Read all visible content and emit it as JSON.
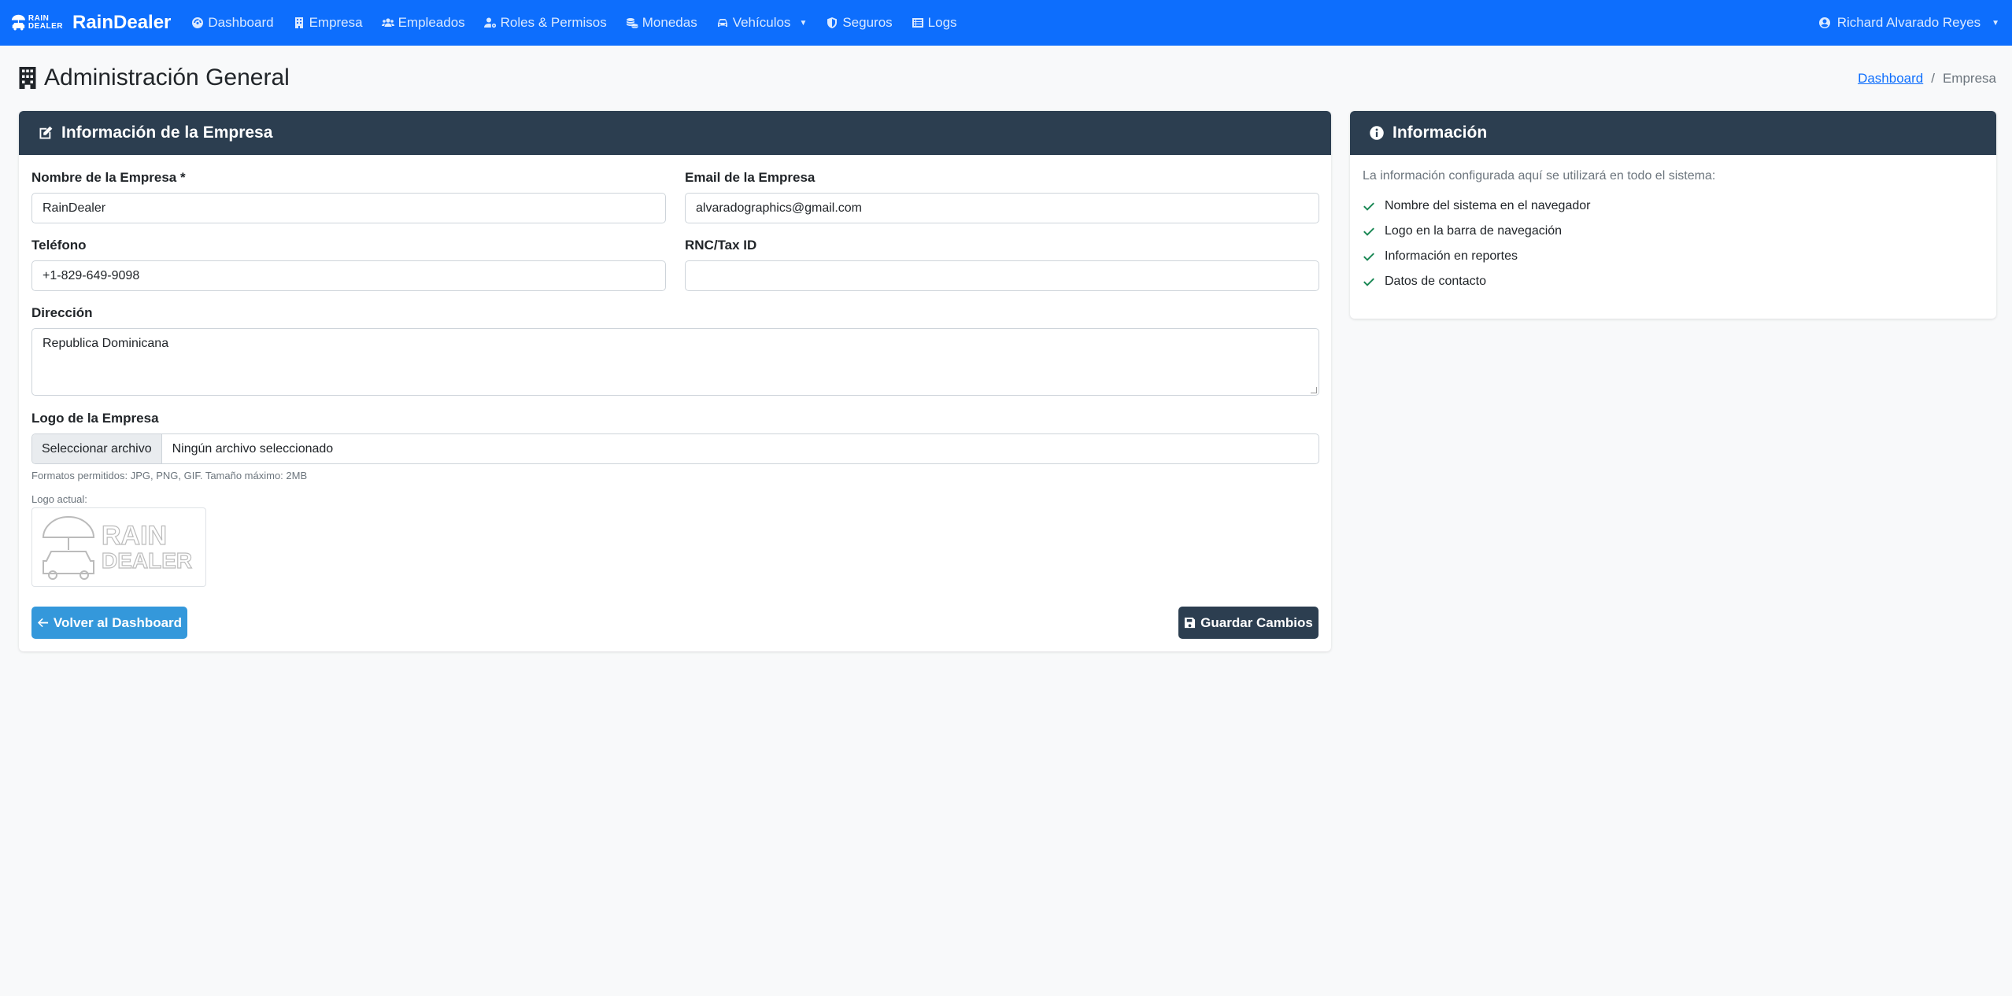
{
  "navbar": {
    "logo_line1": "RAIN",
    "logo_line2": "DEALER",
    "brand": "RainDealer",
    "items": [
      {
        "label": "Dashboard",
        "icon": "tachometer-icon"
      },
      {
        "label": "Empresa",
        "icon": "building-icon"
      },
      {
        "label": "Empleados",
        "icon": "users-icon"
      },
      {
        "label": "Roles & Permisos",
        "icon": "user-cog-icon"
      },
      {
        "label": "Monedas",
        "icon": "coins-icon"
      },
      {
        "label": "Vehículos",
        "icon": "car-icon"
      },
      {
        "label": "Seguros",
        "icon": "shield-icon"
      },
      {
        "label": "Logs",
        "icon": "list-icon"
      }
    ],
    "user": "Richard Alvarado Reyes"
  },
  "page": {
    "title": "Administración General",
    "breadcrumb": [
      "Dashboard",
      "/",
      "Empresa"
    ]
  },
  "company_card": {
    "header": "Información de la Empresa",
    "name_label": "Nombre de la Empresa *",
    "name_value": "RainDealer",
    "email_label": "Email de la Empresa",
    "email_value": "alvaradographics@gmail.com",
    "phone_label": "Teléfono",
    "phone_value": "+1-829-649-9098",
    "tax_label": "RNC/Tax ID",
    "tax_value": "",
    "address_label": "Dirección",
    "address_value": "Republica Dominicana",
    "logo_label": "Logo de la Empresa",
    "file_button": "Seleccionar archivo",
    "file_status": "Ningún archivo seleccionado",
    "formats_hint": "Formatos permitidos: JPG, PNG, GIF. Tamaño máximo: 2MB",
    "current_logo_label": "Logo actual:",
    "current_logo_line1": "RAIN",
    "current_logo_line2": "DEALER",
    "back_button": "Volver al Dashboard",
    "save_button": "Guardar Cambios"
  },
  "info_card": {
    "header": "Información",
    "intro": "La información configurada aquí se utilizará en todo el sistema:",
    "items": [
      "Nombre del sistema en el navegador",
      "Logo en la barra de navegación",
      "Información en reportes",
      "Datos de contacto"
    ]
  },
  "colors": {
    "navbar": "#0d6efd",
    "card_header": "#2c3e50",
    "info_button": "#3498db",
    "check": "#198754"
  }
}
